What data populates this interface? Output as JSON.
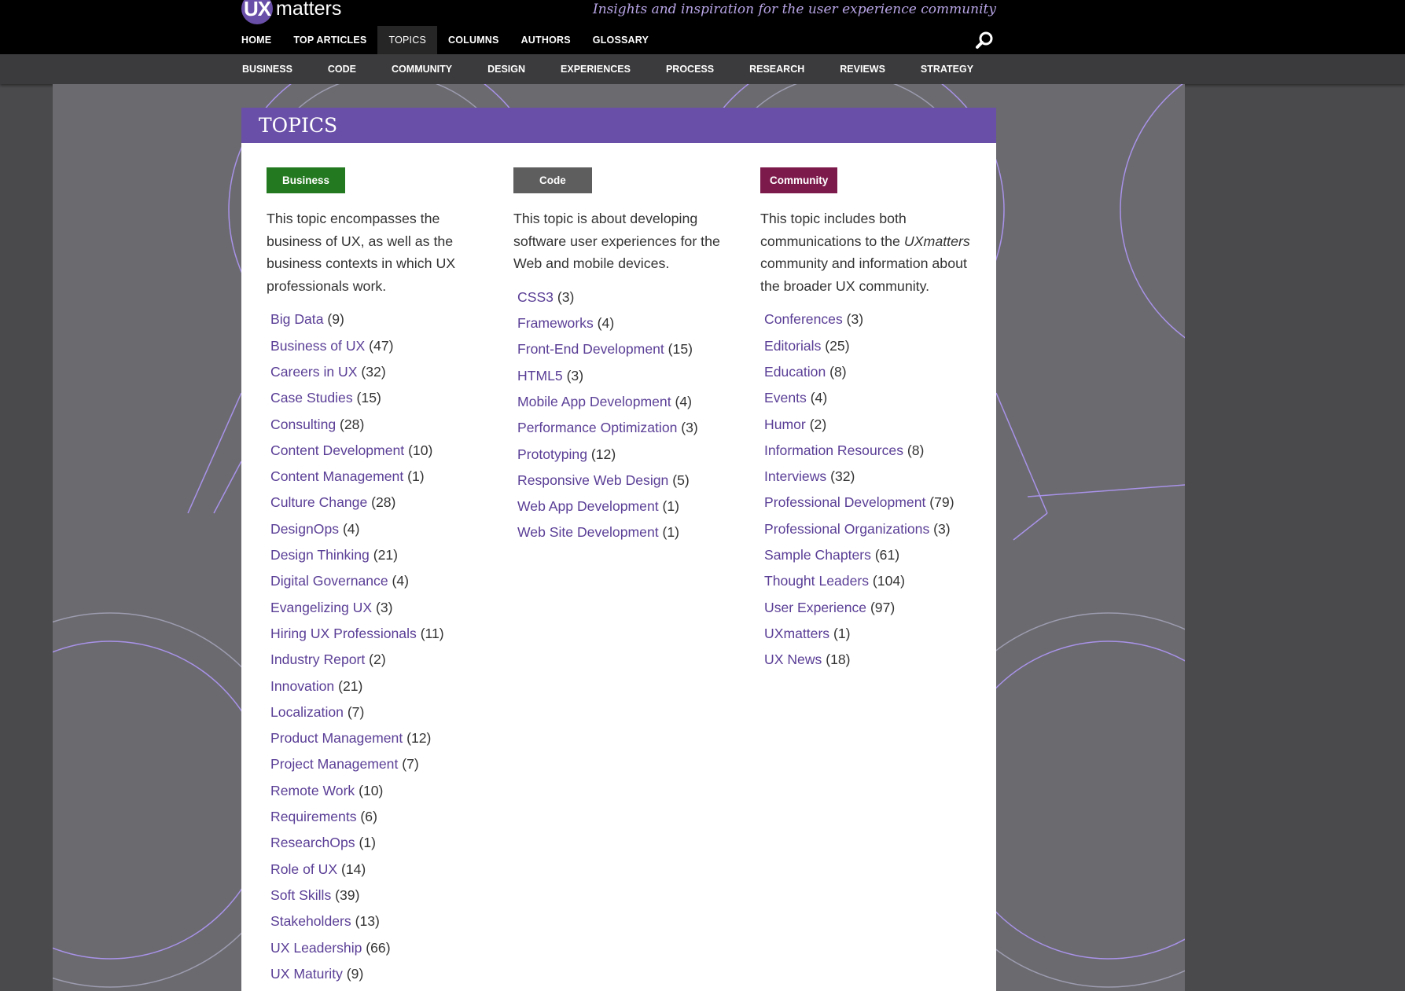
{
  "header": {
    "logo_ux": "UX",
    "logo_matters": "matters",
    "tagline": "Insights and inspiration for the user experience community"
  },
  "main_nav": [
    {
      "label": "HOME",
      "active": false
    },
    {
      "label": "TOP ARTICLES",
      "active": false
    },
    {
      "label": "TOPICS",
      "active": true
    },
    {
      "label": "COLUMNS",
      "active": false
    },
    {
      "label": "AUTHORS",
      "active": false
    },
    {
      "label": "GLOSSARY",
      "active": false
    }
  ],
  "sub_nav": [
    "BUSINESS",
    "CODE",
    "COMMUNITY",
    "DESIGN",
    "EXPERIENCES",
    "PROCESS",
    "RESEARCH",
    "REVIEWS",
    "STRATEGY"
  ],
  "page_title": "TOPICS",
  "columns": [
    {
      "tag": "Business",
      "tag_color": "#23791f",
      "description": "This topic encompasses the business of UX, as well as the business contexts in which UX professionals work.",
      "items": [
        {
          "name": "Big Data",
          "count": "(9)"
        },
        {
          "name": "Business of UX",
          "count": "(47)"
        },
        {
          "name": "Careers in UX",
          "count": "(32)"
        },
        {
          "name": "Case Studies",
          "count": "(15)"
        },
        {
          "name": "Consulting",
          "count": "(28)"
        },
        {
          "name": "Content Development",
          "count": "(10)"
        },
        {
          "name": "Content Management",
          "count": "(1)"
        },
        {
          "name": "Culture Change",
          "count": "(28)"
        },
        {
          "name": "DesignOps",
          "count": "(4)"
        },
        {
          "name": "Design Thinking",
          "count": "(21)"
        },
        {
          "name": "Digital Governance",
          "count": "(4)"
        },
        {
          "name": "Evangelizing UX",
          "count": "(3)"
        },
        {
          "name": "Hiring UX Professionals",
          "count": "(11)"
        },
        {
          "name": "Industry Report",
          "count": "(2)"
        },
        {
          "name": "Innovation",
          "count": "(21)"
        },
        {
          "name": "Localization",
          "count": "(7)"
        },
        {
          "name": "Product Management",
          "count": "(12)"
        },
        {
          "name": "Project Management",
          "count": "(7)"
        },
        {
          "name": "Remote Work",
          "count": "(10)"
        },
        {
          "name": "Requirements",
          "count": "(6)"
        },
        {
          "name": "ResearchOps",
          "count": "(1)"
        },
        {
          "name": "Role of UX",
          "count": "(14)"
        },
        {
          "name": "Soft Skills",
          "count": "(39)"
        },
        {
          "name": "Stakeholders",
          "count": "(13)"
        },
        {
          "name": "UX Leadership",
          "count": "(66)"
        },
        {
          "name": "UX Maturity",
          "count": "(9)"
        }
      ]
    },
    {
      "tag": "Code",
      "tag_color": "#5e5e5e",
      "description": "This topic is about developing software user experiences for the Web and mobile devices.",
      "items": [
        {
          "name": "CSS3",
          "count": "(3)"
        },
        {
          "name": "Frameworks",
          "count": "(4)"
        },
        {
          "name": "Front-End Development",
          "count": "(15)"
        },
        {
          "name": "HTML5",
          "count": "(3)"
        },
        {
          "name": "Mobile App Development",
          "count": "(4)"
        },
        {
          "name": "Performance Optimization",
          "count": "(3)"
        },
        {
          "name": "Prototyping",
          "count": "(12)"
        },
        {
          "name": "Responsive Web Design",
          "count": "(5)"
        },
        {
          "name": "Web App Development",
          "count": "(1)"
        },
        {
          "name": "Web Site Development",
          "count": "(1)"
        }
      ]
    },
    {
      "tag": "Community",
      "tag_color": "#7d1a4c",
      "description_pre": "This topic includes both communications to the ",
      "description_em": "UXmatters",
      "description_post": " community and information about the broader UX community.",
      "items": [
        {
          "name": "Conferences",
          "count": "(3)"
        },
        {
          "name": "Editorials",
          "count": "(25)"
        },
        {
          "name": "Education",
          "count": "(8)"
        },
        {
          "name": "Events",
          "count": "(4)"
        },
        {
          "name": "Humor",
          "count": "(2)"
        },
        {
          "name": "Information Resources",
          "count": "(8)"
        },
        {
          "name": "Interviews",
          "count": "(32)"
        },
        {
          "name": "Professional Development",
          "count": "(79)"
        },
        {
          "name": "Professional Organizations",
          "count": "(3)"
        },
        {
          "name": "Sample Chapters",
          "count": "(61)"
        },
        {
          "name": "Thought Leaders",
          "count": "(104)"
        },
        {
          "name": "User Experience",
          "count": "(97)"
        },
        {
          "name": "UXmatters",
          "count": "(1)"
        },
        {
          "name": "UX News",
          "count": "(18)"
        }
      ]
    }
  ],
  "colors": {
    "accent": "#6a4fa8",
    "link": "#5a3e96",
    "tagline": "#b8a5e6"
  },
  "icons": {
    "search": "search-icon"
  }
}
